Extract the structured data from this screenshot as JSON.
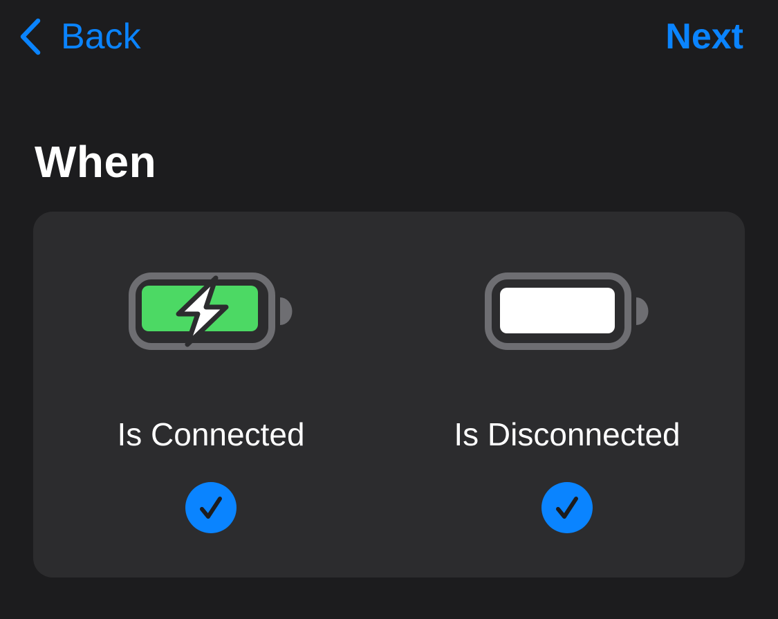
{
  "nav": {
    "back_label": "Back",
    "next_label": "Next"
  },
  "section": {
    "title": "When"
  },
  "options": [
    {
      "label": "Is Connected",
      "icon": "battery-charging-icon",
      "selected": true
    },
    {
      "label": "Is Disconnected",
      "icon": "battery-full-icon",
      "selected": true
    }
  ],
  "colors": {
    "background": "#1c1c1e",
    "card": "#2c2c2e",
    "accent": "#0a84ff",
    "battery_outline": "#6e6e72",
    "battery_green": "#4cd964",
    "text": "#ffffff"
  }
}
